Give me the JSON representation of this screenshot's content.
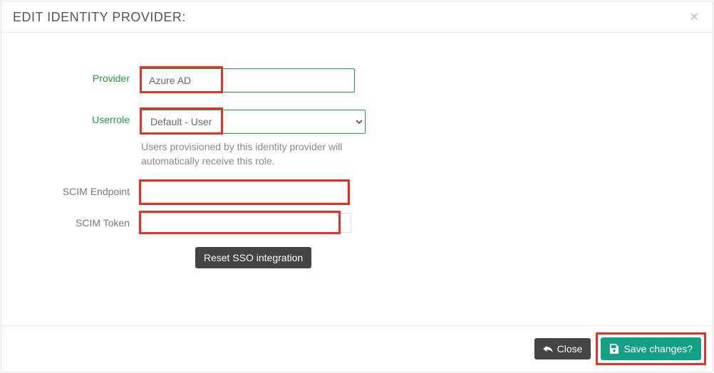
{
  "header": {
    "title": "EDIT IDENTITY PROVIDER:",
    "close_glyph": "×"
  },
  "form": {
    "provider_label": "Provider",
    "provider_value": "Azure AD",
    "userrole_label": "Userrole",
    "userrole_selected": "Default - User",
    "userrole_options": [
      "Default - User"
    ],
    "userrole_help": "Users provisioned by this identity provider will automatically receive this role.",
    "scim_endpoint_label": "SCIM Endpoint",
    "scim_endpoint_value": "",
    "scim_token_label": "SCIM Token",
    "scim_token_value": "",
    "reset_label": "Reset SSO integration"
  },
  "footer": {
    "close_label": "Close",
    "save_label": "Save changes?"
  }
}
